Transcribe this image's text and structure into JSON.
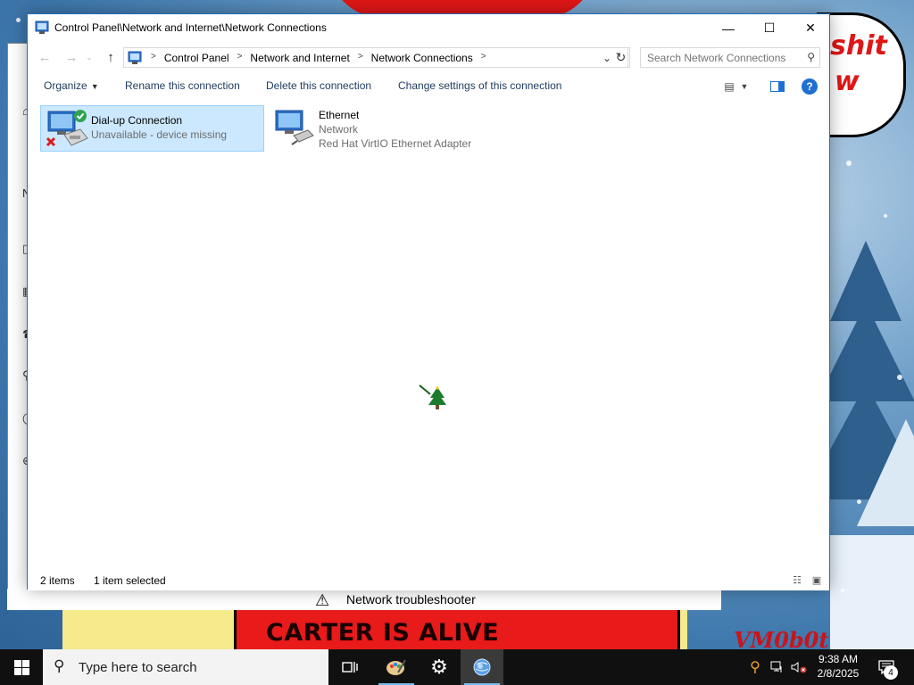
{
  "window": {
    "title": "Control Panel\\Network and Internet\\Network Connections",
    "minimize_glyph": "—",
    "maximize_glyph": "☐",
    "close_glyph": "✕"
  },
  "address": {
    "crumbs": [
      "Control Panel",
      "Network and Internet",
      "Network Connections"
    ],
    "separator": ">"
  },
  "search": {
    "placeholder": "Search Network Connections"
  },
  "toolbar": {
    "organize": "Organize",
    "rename": "Rename this connection",
    "delete": "Delete this connection",
    "change_settings": "Change settings of this connection"
  },
  "connections": [
    {
      "name": "Dial-up Connection",
      "status": "Unavailable - device missing",
      "device": "",
      "selected": true,
      "icon": "dialup-connection-icon"
    },
    {
      "name": "Ethernet",
      "status": "Network",
      "device": "Red Hat VirtIO Ethernet Adapter",
      "selected": false,
      "icon": "ethernet-connection-icon"
    }
  ],
  "statusbar": {
    "item_count": "2 items",
    "selection": "1 item selected"
  },
  "background_window": {
    "title": "",
    "troubleshooter": "Network troubleshooter"
  },
  "wallpaper": {
    "banner": "CARTER IS ALIVE",
    "signature": "VM0b0t",
    "bubble_line1": "shit",
    "bubble_line2": "w"
  },
  "taskbar": {
    "search_placeholder": "Type here to search",
    "time": "9:38 AM",
    "date": "2/8/2025",
    "notification_count": "4"
  },
  "colors": {
    "selection_bg": "#cce8ff",
    "selection_border": "#99d1ff",
    "accent": "#1f6fd1",
    "taskbar": "#101010"
  }
}
